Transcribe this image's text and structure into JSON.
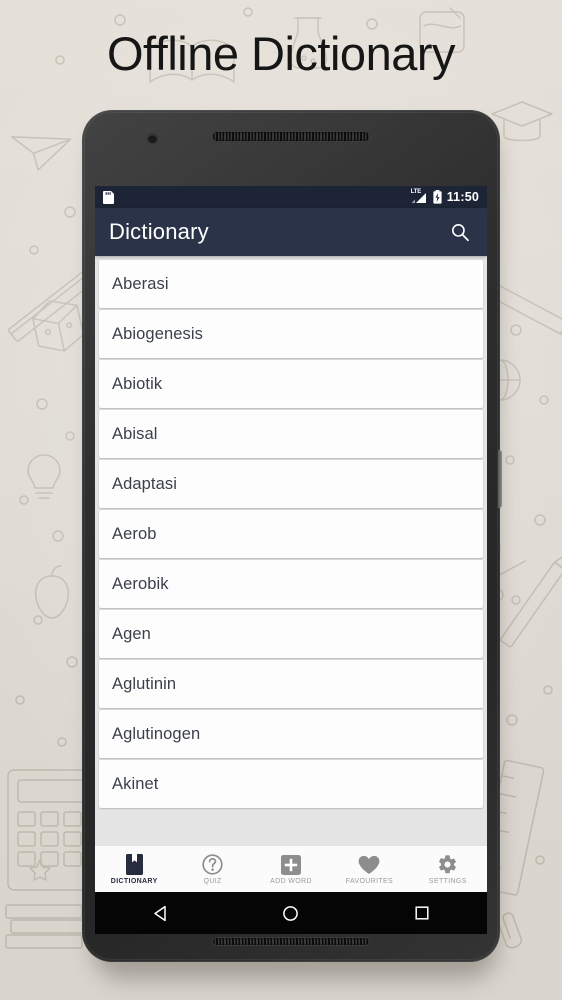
{
  "hero": {
    "title": "Offline Dictionary"
  },
  "status_bar": {
    "time": "11:50",
    "network_label": "LTE",
    "icons": [
      "sd-card-icon",
      "lte-signal-icon",
      "battery-charging-icon"
    ]
  },
  "app_bar": {
    "title": "Dictionary",
    "search_icon": "search-icon"
  },
  "word_list": {
    "items": [
      {
        "word": "Aberasi"
      },
      {
        "word": "Abiogenesis"
      },
      {
        "word": "Abiotik"
      },
      {
        "word": "Abisal"
      },
      {
        "word": "Adaptasi"
      },
      {
        "word": "Aerob"
      },
      {
        "word": "Aerobik"
      },
      {
        "word": "Agen"
      },
      {
        "word": "Aglutinin"
      },
      {
        "word": "Aglutinogen"
      },
      {
        "word": "Akinet"
      }
    ]
  },
  "bottom_nav": {
    "items": [
      {
        "label": "DICTIONARY",
        "icon": "book-icon",
        "active": true
      },
      {
        "label": "QUIZ",
        "icon": "question-circle-icon",
        "active": false
      },
      {
        "label": "ADD WORD",
        "icon": "plus-square-icon",
        "active": false
      },
      {
        "label": "FAVOURITES",
        "icon": "heart-icon",
        "active": false
      },
      {
        "label": "SETTINGS",
        "icon": "gear-icon",
        "active": false
      }
    ]
  },
  "android_nav": {
    "back": "back-triangle-icon",
    "home": "home-circle-icon",
    "recents": "recents-square-icon"
  },
  "colors": {
    "app_bar": "#2b3349",
    "status_bar": "#1d2436",
    "page_background": "#e9e4dc",
    "list_background": "#e4e4e4",
    "word_text": "#3a3f4a",
    "nav_active": "#262d3f",
    "nav_inactive": "#9b9b9b"
  }
}
